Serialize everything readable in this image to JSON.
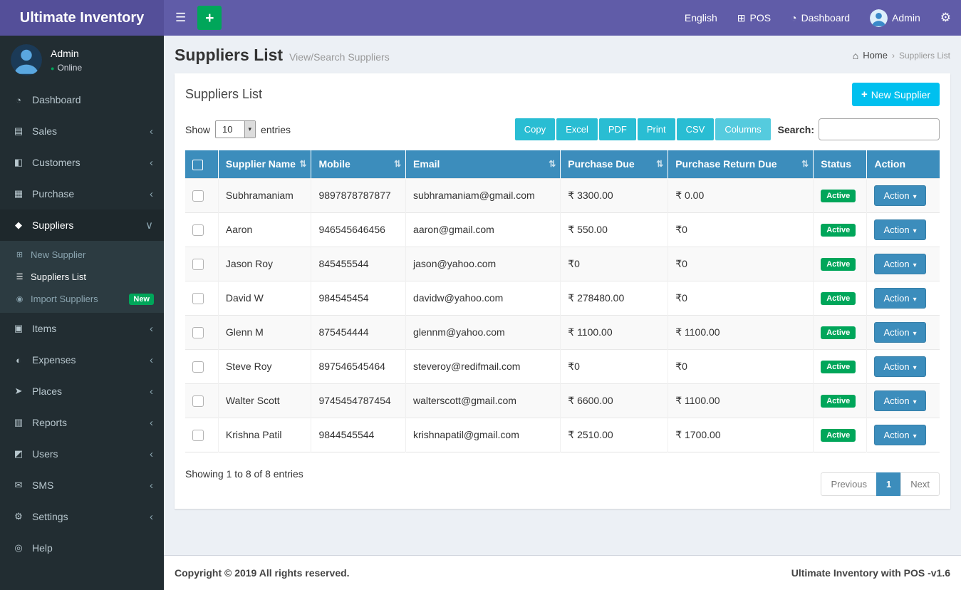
{
  "app": {
    "name": "Ultimate Inventory"
  },
  "topbar": {
    "menu_icon": "☰",
    "quick_add_label": "+",
    "language": "English",
    "pos": "POS",
    "pos_icon": "⊞",
    "dashboard": "Dashboard",
    "dashboard_icon": "◔",
    "user": "Admin",
    "settings_icon": "⚙"
  },
  "sidebar": {
    "user": {
      "name": "Admin",
      "status": "Online",
      "status_icon": "●"
    },
    "menu": [
      {
        "id": "dashboard",
        "label": "Dashboard",
        "icon": "◔",
        "chevron": ""
      },
      {
        "id": "sales",
        "label": "Sales",
        "icon": "▤",
        "chevron": "‹"
      },
      {
        "id": "customers",
        "label": "Customers",
        "icon": "◧",
        "chevron": "‹"
      },
      {
        "id": "purchase",
        "label": "Purchase",
        "icon": "▦",
        "chevron": "‹"
      },
      {
        "id": "suppliers",
        "label": "Suppliers",
        "icon": "◆",
        "chevron": "∨",
        "active": true,
        "submenu": [
          {
            "id": "new-supplier",
            "label": "New Supplier",
            "icon": "⊞"
          },
          {
            "id": "suppliers-list",
            "label": "Suppliers List",
            "icon": "☰",
            "active": true
          },
          {
            "id": "import-suppliers",
            "label": "Import Suppliers",
            "icon": "◉",
            "badge": "New"
          }
        ]
      },
      {
        "id": "items",
        "label": "Items",
        "icon": "▣",
        "chevron": "‹"
      },
      {
        "id": "expenses",
        "label": "Expenses",
        "icon": "◐",
        "chevron": "‹"
      },
      {
        "id": "places",
        "label": "Places",
        "icon": "➤",
        "chevron": "‹"
      },
      {
        "id": "reports",
        "label": "Reports",
        "icon": "▥",
        "chevron": "‹"
      },
      {
        "id": "users",
        "label": "Users",
        "icon": "◩",
        "chevron": "‹"
      },
      {
        "id": "sms",
        "label": "SMS",
        "icon": "✉",
        "chevron": "‹"
      },
      {
        "id": "settings",
        "label": "Settings",
        "icon": "⚙",
        "chevron": "‹"
      },
      {
        "id": "help",
        "label": "Help",
        "icon": "◎",
        "chevron": ""
      }
    ]
  },
  "page_header": {
    "title": "Suppliers List",
    "subtitle": "View/Search Suppliers",
    "breadcrumb": {
      "home_icon": "⌂",
      "home": "Home",
      "separator": "›",
      "current": "Suppliers List"
    }
  },
  "box": {
    "title": "Suppliers List",
    "new_supplier_icon": "+",
    "new_supplier_label": "New Supplier",
    "show_label": "Show",
    "page_length": "10",
    "select_caret": "▾",
    "entries_label": "entries",
    "export_buttons": [
      "Copy",
      "Excel",
      "PDF",
      "Print",
      "CSV",
      "Columns"
    ],
    "search_label": "Search:",
    "search_value": "",
    "info_text": "Showing 1 to 8 of 8 entries",
    "pagination": {
      "previous": "Previous",
      "current_page": "1",
      "next": "Next"
    }
  },
  "table": {
    "sort_icon": "⇅",
    "action_label": "Action",
    "action_caret": "▾",
    "headers": [
      {
        "label": "Supplier Name",
        "sortable": true
      },
      {
        "label": "Mobile",
        "sortable": true
      },
      {
        "label": "Email",
        "sortable": true
      },
      {
        "label": "Purchase Due",
        "sortable": true
      },
      {
        "label": "Purchase Return Due",
        "sortable": true
      },
      {
        "label": "Status",
        "sortable": false
      },
      {
        "label": "Action",
        "sortable": false
      }
    ],
    "rows": [
      {
        "name": "Subhramaniam",
        "mobile": "9897878787877",
        "email": "subhramaniam@gmail.com",
        "purchase_due": "₹ 3300.00",
        "purchase_return_due": "₹ 0.00",
        "status": "Active"
      },
      {
        "name": "Aaron",
        "mobile": "946545646456",
        "email": "aaron@gmail.com",
        "purchase_due": "₹ 550.00",
        "purchase_return_due": "₹0",
        "status": "Active"
      },
      {
        "name": "Jason Roy",
        "mobile": "845455544",
        "email": "jason@yahoo.com",
        "purchase_due": "₹0",
        "purchase_return_due": "₹0",
        "status": "Active"
      },
      {
        "name": "David W",
        "mobile": "984545454",
        "email": "davidw@yahoo.com",
        "purchase_due": "₹ 278480.00",
        "purchase_return_due": "₹0",
        "status": "Active"
      },
      {
        "name": "Glenn M",
        "mobile": "875454444",
        "email": "glennm@yahoo.com",
        "purchase_due": "₹ 1100.00",
        "purchase_return_due": "₹ 1100.00",
        "status": "Active"
      },
      {
        "name": "Steve Roy",
        "mobile": "897546545464",
        "email": "steveroy@redifmail.com",
        "purchase_due": "₹0",
        "purchase_return_due": "₹0",
        "status": "Active"
      },
      {
        "name": "Walter Scott",
        "mobile": "9745454787454",
        "email": "walterscott@gmail.com",
        "purchase_due": "₹ 6600.00",
        "purchase_return_due": "₹ 1100.00",
        "status": "Active"
      },
      {
        "name": "Krishna Patil",
        "mobile": "9844545544",
        "email": "krishnapatil@gmail.com",
        "purchase_due": "₹ 2510.00",
        "purchase_return_due": "₹ 1700.00",
        "status": "Active"
      }
    ]
  },
  "footer": {
    "left": "Copyright © 2019 All rights reserved.",
    "right": "Ultimate Inventory with POS -v1.6"
  },
  "colors": {
    "navbar": "#605ca8",
    "logo_bg": "#544f99",
    "sidebar_bg": "#222d32",
    "submenu_bg": "#2c3b41",
    "green": "#00a65a",
    "new_supplier_button": "#00c0ef",
    "export_button": "#29bdd3",
    "table_header": "#3c8dbc",
    "status_badge": "#00a65a"
  }
}
